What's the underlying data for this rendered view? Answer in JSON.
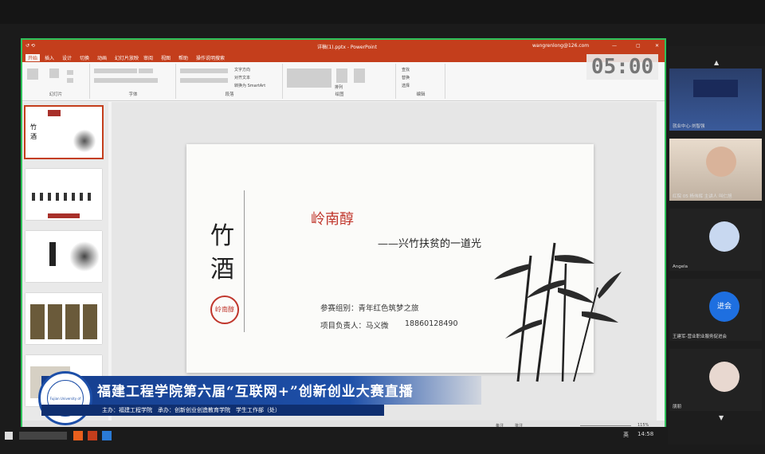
{
  "ppt": {
    "file_title": "详稿(1).pptx - PowerPoint",
    "account": "wangrenlong@126.com",
    "tabs": [
      "开始",
      "插入",
      "设计",
      "切换",
      "动画",
      "幻灯片放映",
      "审阅",
      "视图",
      "帮助",
      "操作说明搜索"
    ],
    "ribbon_groups": [
      "幻灯片",
      "字体",
      "段落",
      "绘图",
      "编辑"
    ],
    "ribbon_labels": {
      "new_slide": "新建\n幻灯片",
      "text_dir": "文字方向",
      "align_text": "对齐文本",
      "smartart": "转换为 SmartArt",
      "arrange": "排列",
      "find": "查找",
      "replace": "替换",
      "select": "选择"
    },
    "timer": "05:00",
    "status": {
      "notes": "备注",
      "comments": "批注",
      "zoom": "115%"
    }
  },
  "slide": {
    "title_vertical": [
      "竹",
      "酒"
    ],
    "main_title": "岭南醇",
    "subtitle": "——兴竹扶贫的一道光",
    "seal_text": "岭南醇",
    "group_line": "参赛组别：青年红色筑梦之旅",
    "owner_line": "项目负责人：马义微",
    "phone": "18860128490"
  },
  "participants": [
    {
      "name": "就业中心-刘智强"
    },
    {
      "name": "红院 05 杨伟辉 主讲人 叫仁旭"
    },
    {
      "name": "Angela"
    },
    {
      "name": "王建军-营业职业服务促进会",
      "join": "进会"
    },
    {
      "name": "朋朋"
    }
  ],
  "banner": {
    "title": "福建工程学院第六届“互联网+”创新创业大赛直播",
    "sub": "主办：福建工程学院　承办：创新创业创造教育学院　学生工作部（处）",
    "logo_text": "Fujian University of Technology"
  },
  "taskbar": {
    "time": "14:58",
    "lang": "英"
  },
  "colors": {
    "accent": "#c43e1c",
    "slide_red": "#a8302a",
    "title_red": "#c0362c",
    "banner": "#1d4fa8",
    "green_border": "#2fc25b"
  }
}
